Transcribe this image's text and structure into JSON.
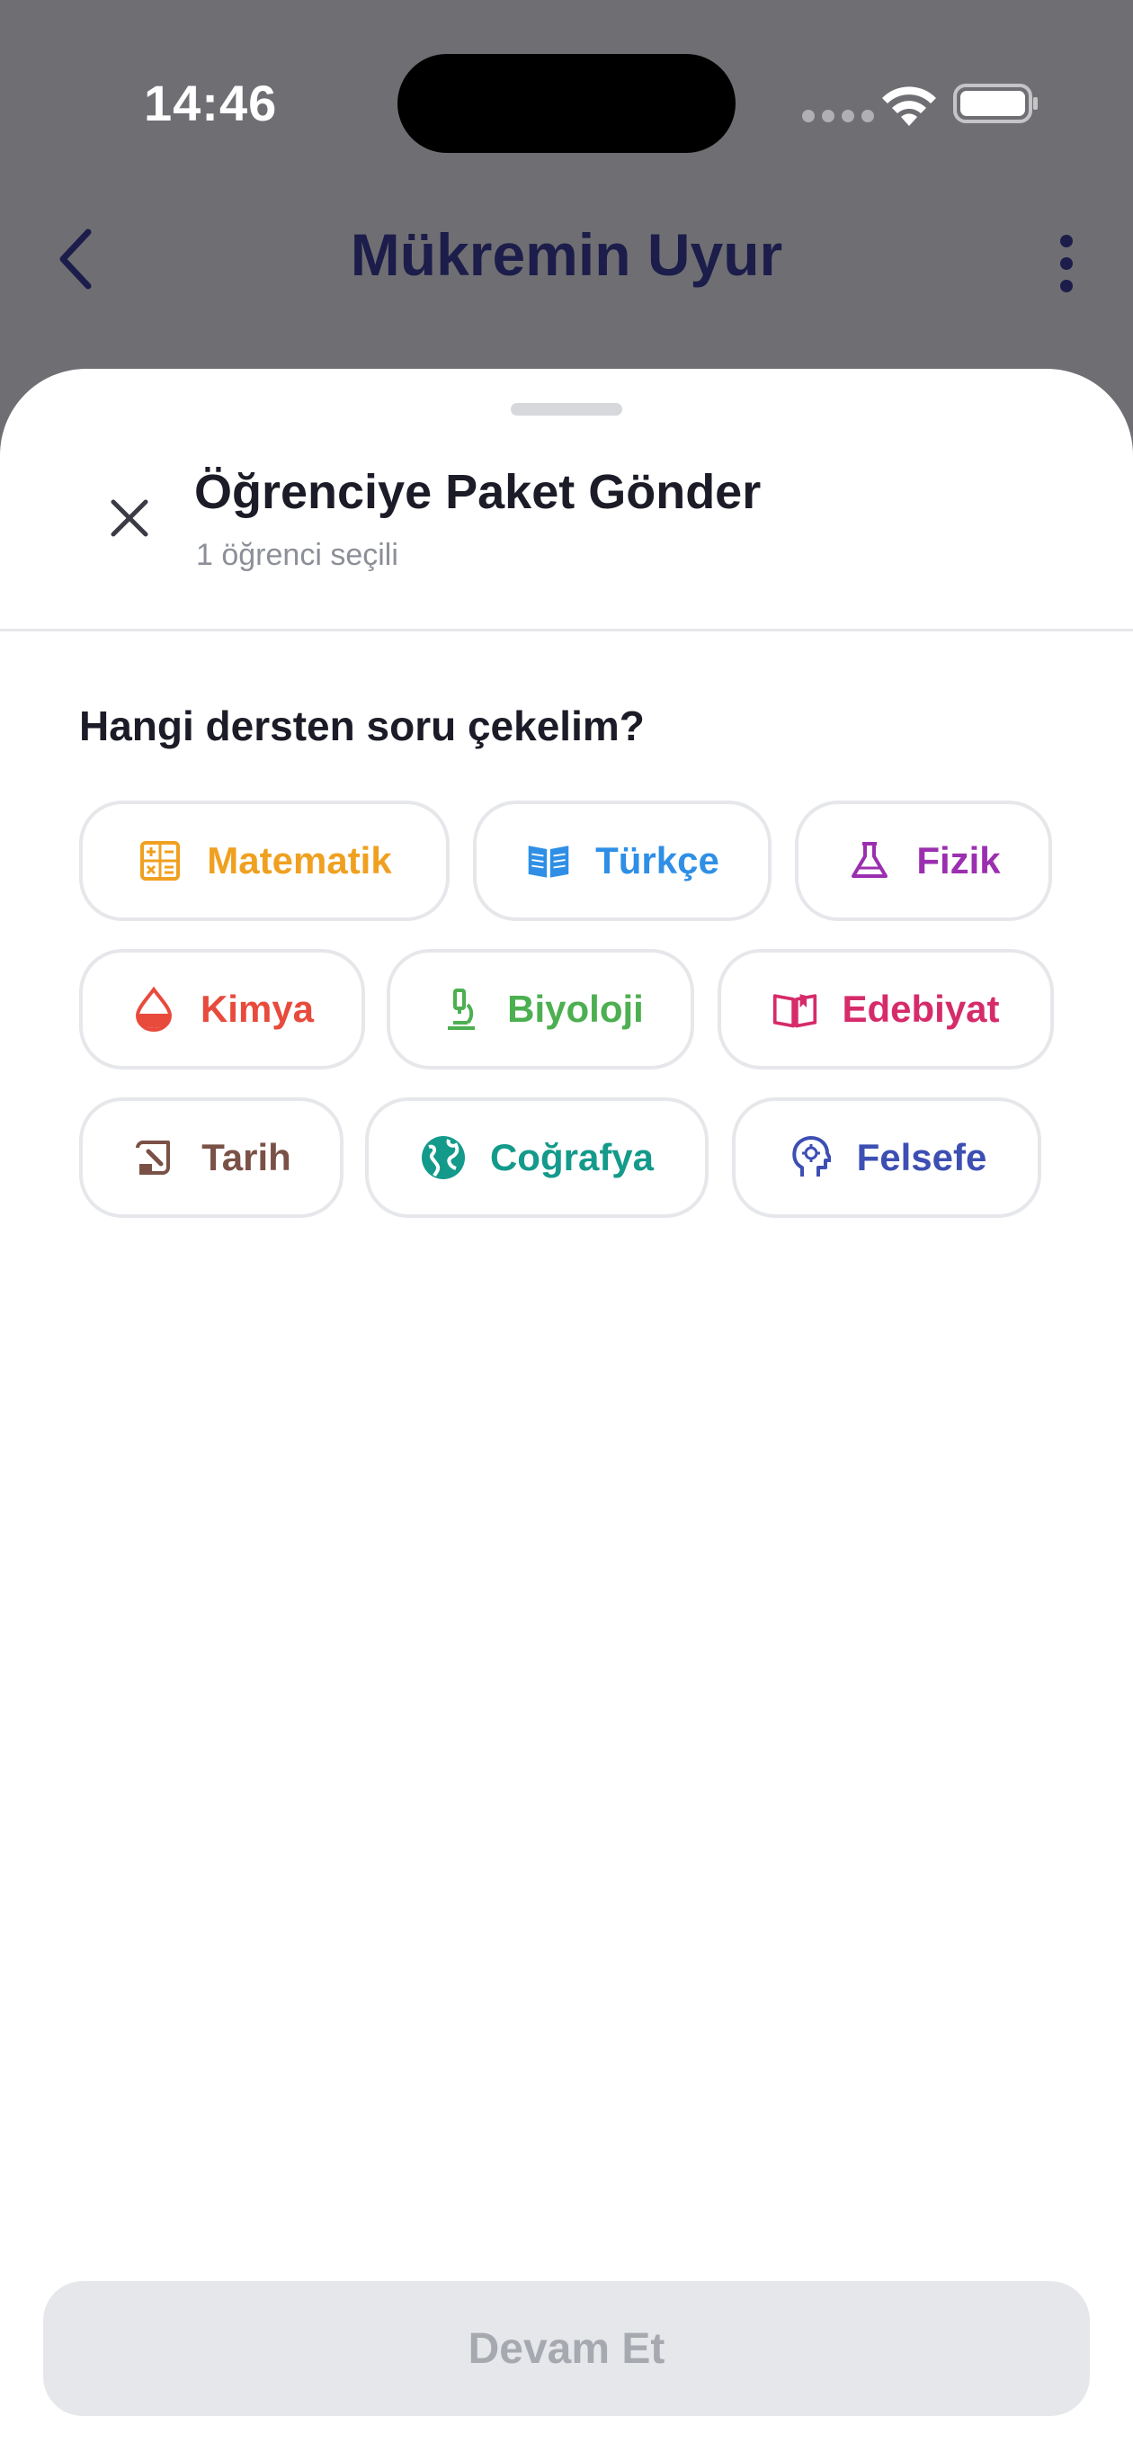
{
  "status_bar": {
    "time": "14:46"
  },
  "nav": {
    "title": "Mükremin Uyur",
    "back_icon": "chevron-left-icon",
    "more_icon": "more-vertical-icon"
  },
  "sheet": {
    "title": "Öğrenciye Paket Gönder",
    "subtitle": "1 öğrenci seçili",
    "close_icon": "close-icon",
    "question": "Hangi dersten soru çekelim?",
    "subjects": [
      {
        "label": "Matematik",
        "icon": "calculator-icon",
        "color": "#f0a020"
      },
      {
        "label": "Türkçe",
        "icon": "book-open-icon",
        "color": "#2f8fe6"
      },
      {
        "label": "Fizik",
        "icon": "flask-icon",
        "color": "#9b2fb0"
      },
      {
        "label": "Kimya",
        "icon": "drop-icon",
        "color": "#e84a3c"
      },
      {
        "label": "Biyoloji",
        "icon": "microscope-icon",
        "color": "#4caf50"
      },
      {
        "label": "Edebiyat",
        "icon": "book-icon",
        "color": "#d62b6a"
      },
      {
        "label": "Tarih",
        "icon": "scroll-icon",
        "color": "#7a5146"
      },
      {
        "label": "Coğrafya",
        "icon": "globe-icon",
        "color": "#149a8b"
      },
      {
        "label": "Felsefe",
        "icon": "brain-head-icon",
        "color": "#3d4fb3"
      }
    ],
    "continue_label": "Devam Et"
  }
}
